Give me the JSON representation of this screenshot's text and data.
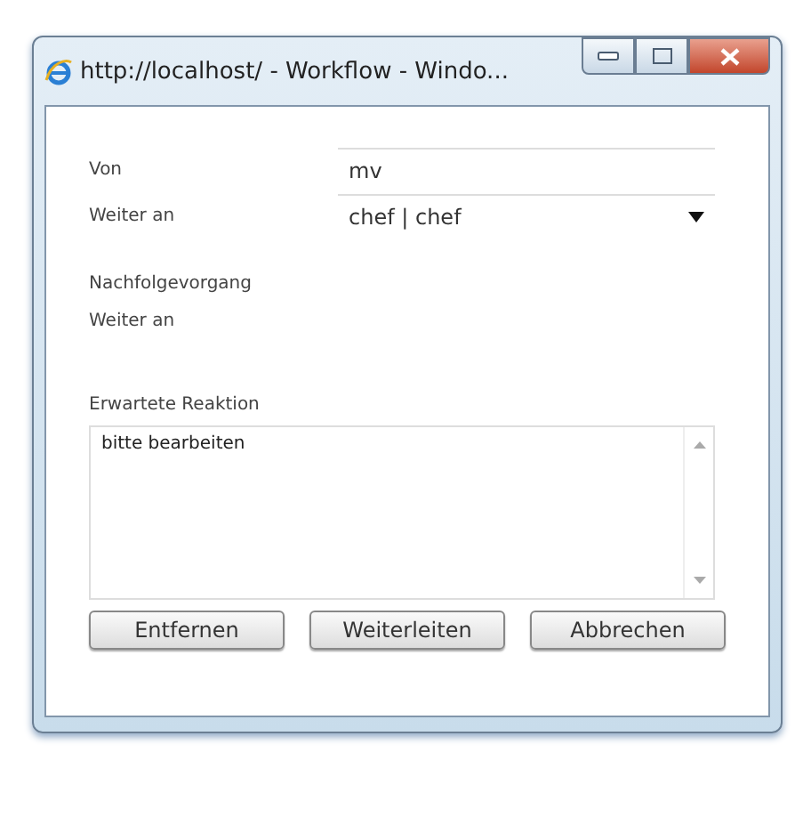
{
  "window": {
    "title": "http://localhost/ - Workflow - Windo..."
  },
  "fields": [
    {
      "label": "Von",
      "value": "mv",
      "kind": "text"
    },
    {
      "label": "Weiter an",
      "value": "chef | chef",
      "kind": "select"
    }
  ],
  "successor": {
    "heading": "Nachfolgevorgang",
    "label": "Weiter an"
  },
  "reaction": {
    "label": "Erwartete Reaktion",
    "value": "bitte bearbeiten"
  },
  "buttons": [
    "Entfernen",
    "Weiterleiten",
    "Abbrechen"
  ]
}
